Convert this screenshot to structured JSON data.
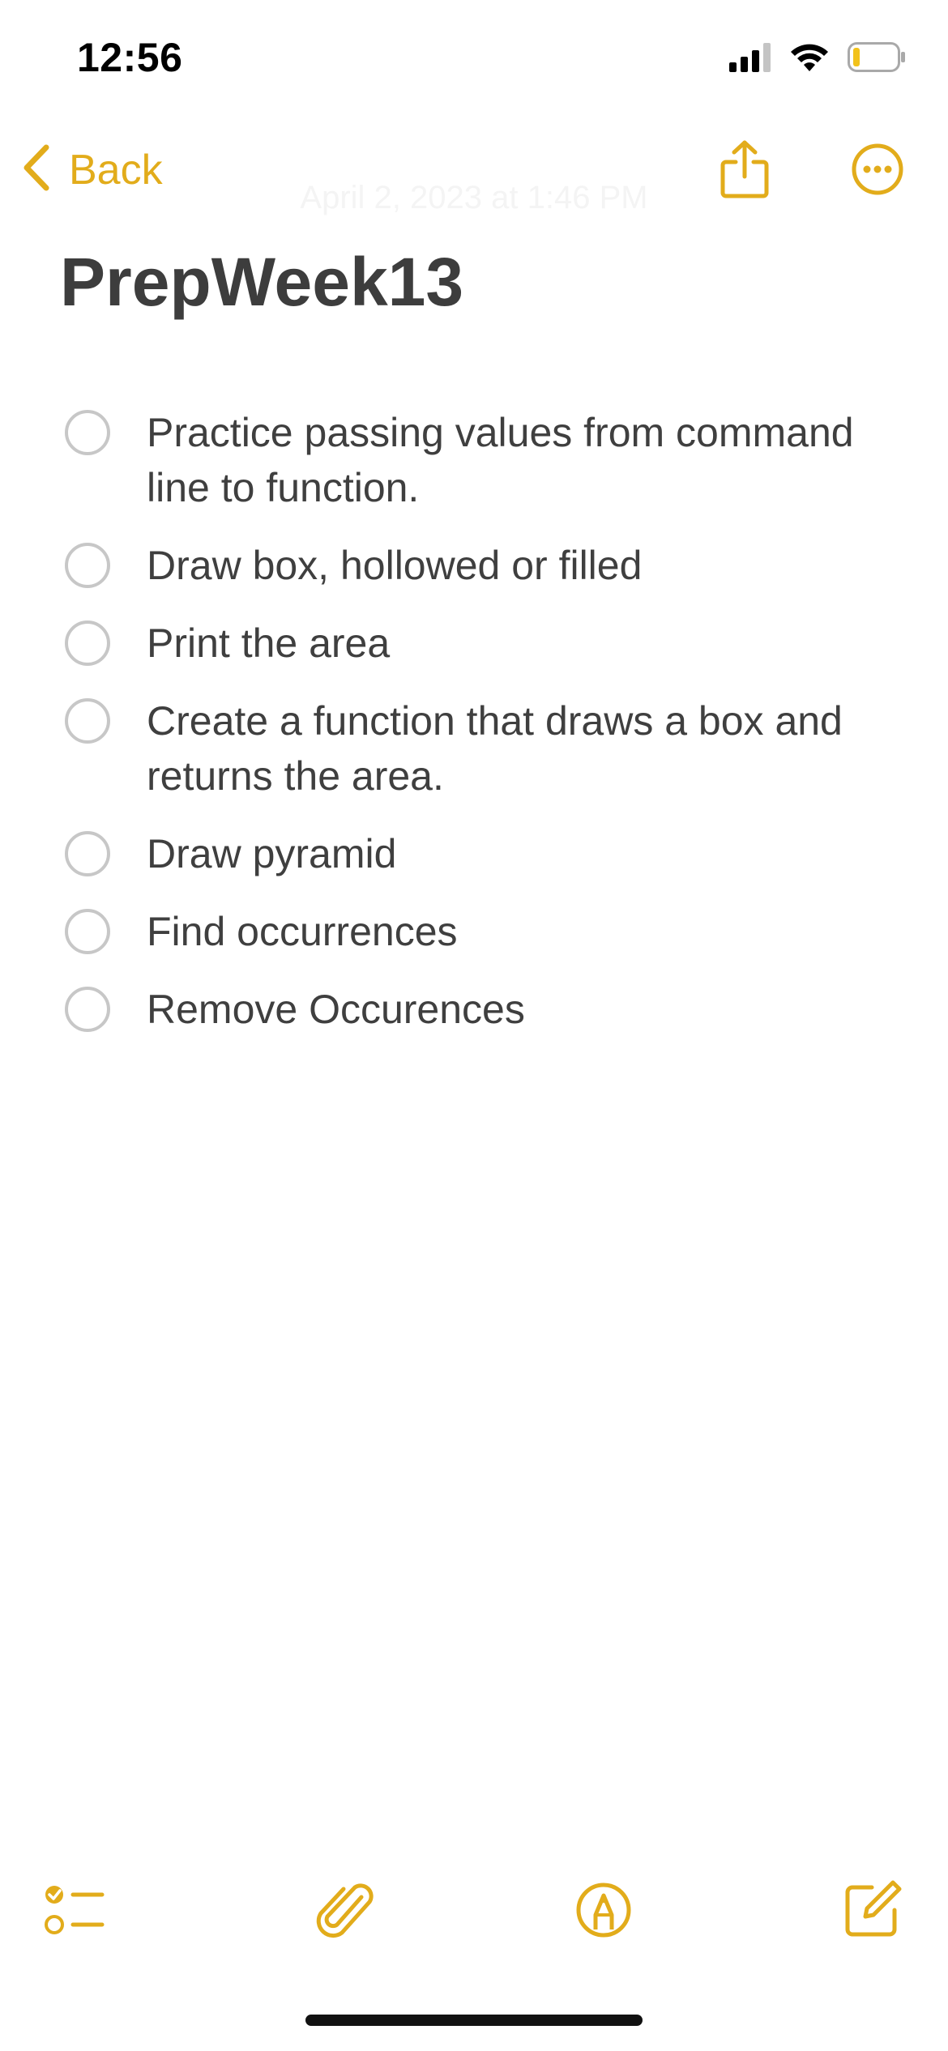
{
  "status_bar": {
    "time": "12:56"
  },
  "nav": {
    "back_label": "Back",
    "date": "April 2, 2023 at 1:46 PM"
  },
  "note": {
    "title": "PrepWeek13",
    "items": [
      {
        "text": "Practice passing values from command line to function.",
        "checked": false
      },
      {
        "text": "Draw box, hollowed or filled",
        "checked": false
      },
      {
        "text": "Print the area",
        "checked": false
      },
      {
        "text": "Create a function that draws a box and returns the area.",
        "checked": false
      },
      {
        "text": "Draw pyramid",
        "checked": false
      },
      {
        "text": "Find occurrences",
        "checked": false
      },
      {
        "text": "Remove Occurences",
        "checked": false
      }
    ]
  },
  "theme": {
    "accent": "#e2ac1b",
    "circle": "#c7c7c7"
  },
  "toolbar": {
    "icons": [
      "checklist-icon",
      "paperclip-icon",
      "markup-pen-icon",
      "compose-icon"
    ]
  }
}
